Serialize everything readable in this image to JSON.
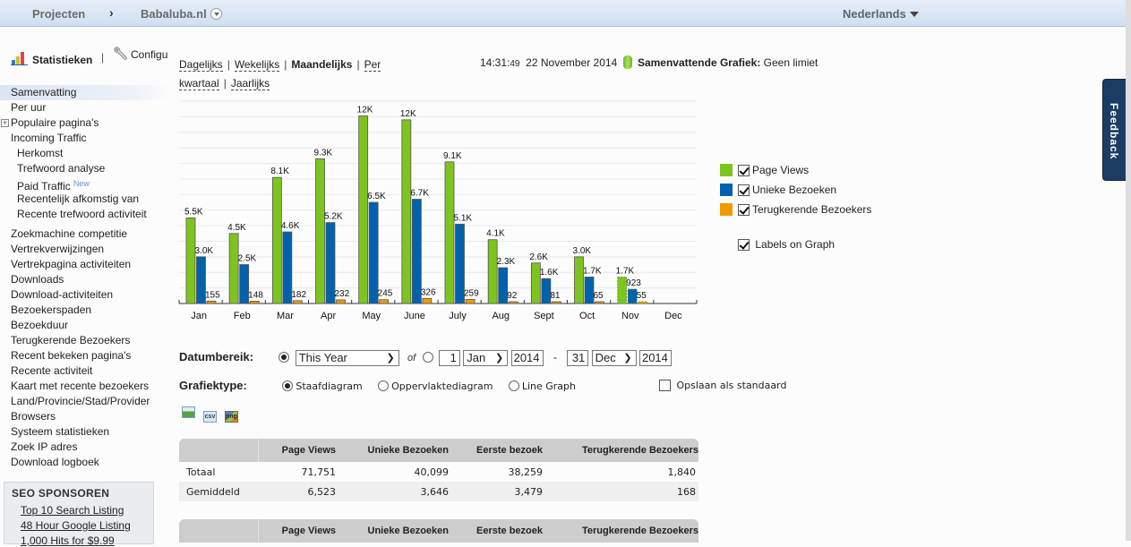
{
  "topbar": {
    "crumb_projects": "Projecten",
    "crumb_separator": "›",
    "crumb_site": "Babaluba.nl",
    "language": "Nederlands"
  },
  "sidebar": {
    "statistics_label": "Statistieken",
    "separator": "|",
    "config_label": "Configuratie",
    "items": [
      {
        "label": "Samenvatting",
        "active": true
      },
      {
        "label": "Per uur"
      },
      {
        "label": "Populaire pagina's",
        "expandable": true
      },
      {
        "label": "Incoming Traffic"
      },
      {
        "label": "Herkomst",
        "sub": true
      },
      {
        "label": "Trefwoord analyse",
        "sub": true
      },
      {
        "label": "Paid Traffic",
        "sub": true,
        "badge": "New"
      },
      {
        "label": "Recentelijk afkomstig van",
        "sub": true
      },
      {
        "label": "Recente trefwoord activiteit",
        "sub": true
      },
      {
        "label": "Zoekmachine competitie",
        "gap": true
      },
      {
        "label": "Vertrekverwijzingen"
      },
      {
        "label": "Vertrekpagina activiteiten"
      },
      {
        "label": "Downloads"
      },
      {
        "label": "Download-activiteiten"
      },
      {
        "label": "Bezoekerspaden"
      },
      {
        "label": "Bezoekduur"
      },
      {
        "label": "Terugkerende Bezoekers"
      },
      {
        "label": "Recent bekeken pagina's"
      },
      {
        "label": "Recente activiteit"
      },
      {
        "label": "Kaart met recente bezoekers"
      },
      {
        "label": "Land/Provincie/Stad/Provider"
      },
      {
        "label": "Browsers"
      },
      {
        "label": "Systeem statistieken"
      },
      {
        "label": "Zoek IP adres"
      },
      {
        "label": "Download logboek"
      }
    ],
    "seo": {
      "title": "SEO SPONSOREN",
      "links": [
        "Top 10 Search Listing",
        "48 Hour Google Listing",
        "1,000 Hits for $9.99"
      ]
    }
  },
  "periods": {
    "daily": "Dagelijks",
    "weekly": "Wekelijks",
    "monthly": "Maandelijks",
    "quarterly_1": "Per",
    "quarterly_2": "kwartaal",
    "yearly": "Jaarlijks",
    "separator": "|"
  },
  "clock": {
    "time": "14:31:",
    "seconds": "49",
    "date": "22 November 2014",
    "summary_label": "Samenvattende Grafiek:",
    "summary_value": "Geen limiet"
  },
  "chart_data": {
    "type": "bar",
    "title": "",
    "xlabel": "",
    "ylabel": "",
    "ylim": [
      0,
      13000
    ],
    "grid": true,
    "legend_position": "right",
    "categories": [
      "Jan",
      "Feb",
      "Mar",
      "Apr",
      "May",
      "June",
      "July",
      "Aug",
      "Sept",
      "Oct",
      "Nov",
      "Dec"
    ],
    "series": [
      {
        "name": "Page Views",
        "color": "#7dc41f",
        "values": [
          5500,
          4500,
          8100,
          9300,
          12050,
          11800,
          9100,
          4100,
          2600,
          3000,
          1700,
          null
        ],
        "labels": [
          "5.5K",
          "4.5K",
          "8.1K",
          "9.3K",
          "12K",
          "12K",
          "9.1K",
          "4.1K",
          "2.6K",
          "3.0K",
          "1.7K",
          ""
        ]
      },
      {
        "name": "Unieke Bezoeken",
        "color": "#0062ad",
        "values": [
          3000,
          2500,
          4600,
          5200,
          6500,
          6700,
          5100,
          2300,
          1600,
          1700,
          923,
          null
        ],
        "labels": [
          "3.0K",
          "2.5K",
          "4.6K",
          "5.2K",
          "6.5K",
          "6.7K",
          "5.1K",
          "2.3K",
          "1.6K",
          "1.7K",
          "923",
          ""
        ]
      },
      {
        "name": "Terugkerende Bezoekers",
        "color": "#f09a00",
        "values": [
          155,
          148,
          182,
          232,
          245,
          326,
          259,
          92,
          81,
          65,
          55,
          null
        ],
        "labels": [
          "155",
          "148",
          "182",
          "232",
          "245",
          "326",
          "259",
          "92",
          "81",
          "65",
          "55",
          ""
        ]
      }
    ],
    "partial_category": "Nov"
  },
  "legend": {
    "items": [
      {
        "label": "Page Views",
        "color": "#7dc41f",
        "checked": true
      },
      {
        "label": "Unieke Bezoeken",
        "color": "#0062ad",
        "checked": true
      },
      {
        "label": "Terugkerende Bezoekers",
        "color": "#f09a00",
        "checked": true
      }
    ],
    "labels_on_graph": "Labels on Graph",
    "labels_on_graph_checked": true
  },
  "date_range": {
    "label": "Datumbereik:",
    "preset_selected": true,
    "preset_value": "This Year",
    "or_label": "of",
    "custom_selected": false,
    "from_day": "1",
    "from_month": "Jan",
    "from_year": "2014",
    "dash": "-",
    "to_day": "31",
    "to_month": "Dec",
    "to_year": "2014"
  },
  "graph_type": {
    "label": "Grafiektype:",
    "options": [
      {
        "label": "Staafdiagram",
        "selected": true
      },
      {
        "label": "Oppervlaktediagram",
        "selected": false
      },
      {
        "label": "Line Graph",
        "selected": false
      }
    ],
    "save_default": "Opslaan als standaard",
    "save_default_checked": false
  },
  "exports": {
    "xls": "excel-export-icon",
    "csv": "csv",
    "png": "png"
  },
  "summary_table": {
    "headers": [
      "",
      "Page Views",
      "Unieke Bezoeken",
      "Eerste bezoek",
      "Terugkerende Bezoekers"
    ],
    "rows": [
      [
        "Totaal",
        "71,751",
        "40,099",
        "38,259",
        "1,840"
      ],
      [
        "Gemiddeld",
        "6,523",
        "3,646",
        "3,479",
        "168"
      ]
    ]
  },
  "second_table": {
    "headers": [
      "",
      "Page Views",
      "Unieke Bezoeken",
      "Eerste bezoek",
      "Terugkerende Bezoekers"
    ]
  },
  "feedback": "Feedback"
}
